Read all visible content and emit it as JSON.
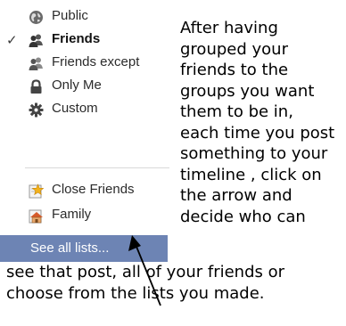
{
  "menu": {
    "items": [
      {
        "label": "Public",
        "icon": "globe-icon",
        "selected": false
      },
      {
        "label": "Friends",
        "icon": "friends-icon",
        "selected": true
      },
      {
        "label": "Friends except",
        "icon": "friends-except-icon",
        "selected": false
      },
      {
        "label": "Only Me",
        "icon": "lock-icon",
        "selected": false
      },
      {
        "label": "Custom",
        "icon": "gear-icon",
        "selected": false
      },
      {
        "label": "Close Friends",
        "icon": "star-list-icon",
        "selected": false
      },
      {
        "label": "Family",
        "icon": "house-icon",
        "selected": false
      }
    ],
    "check_glyph": "✓",
    "see_all_label": "See all lists...",
    "highlight_color": "#6d84b4"
  },
  "instructions": {
    "lines_right": [
      "After having",
      "grouped your",
      "friends to the",
      "groups you want",
      "them to be in,",
      "each time you post",
      "something to your",
      "timeline , click on",
      "the arrow and",
      "decide who can"
    ],
    "lines_bottom": [
      "see that post, all of your friends or",
      "choose from the lists you made."
    ]
  }
}
